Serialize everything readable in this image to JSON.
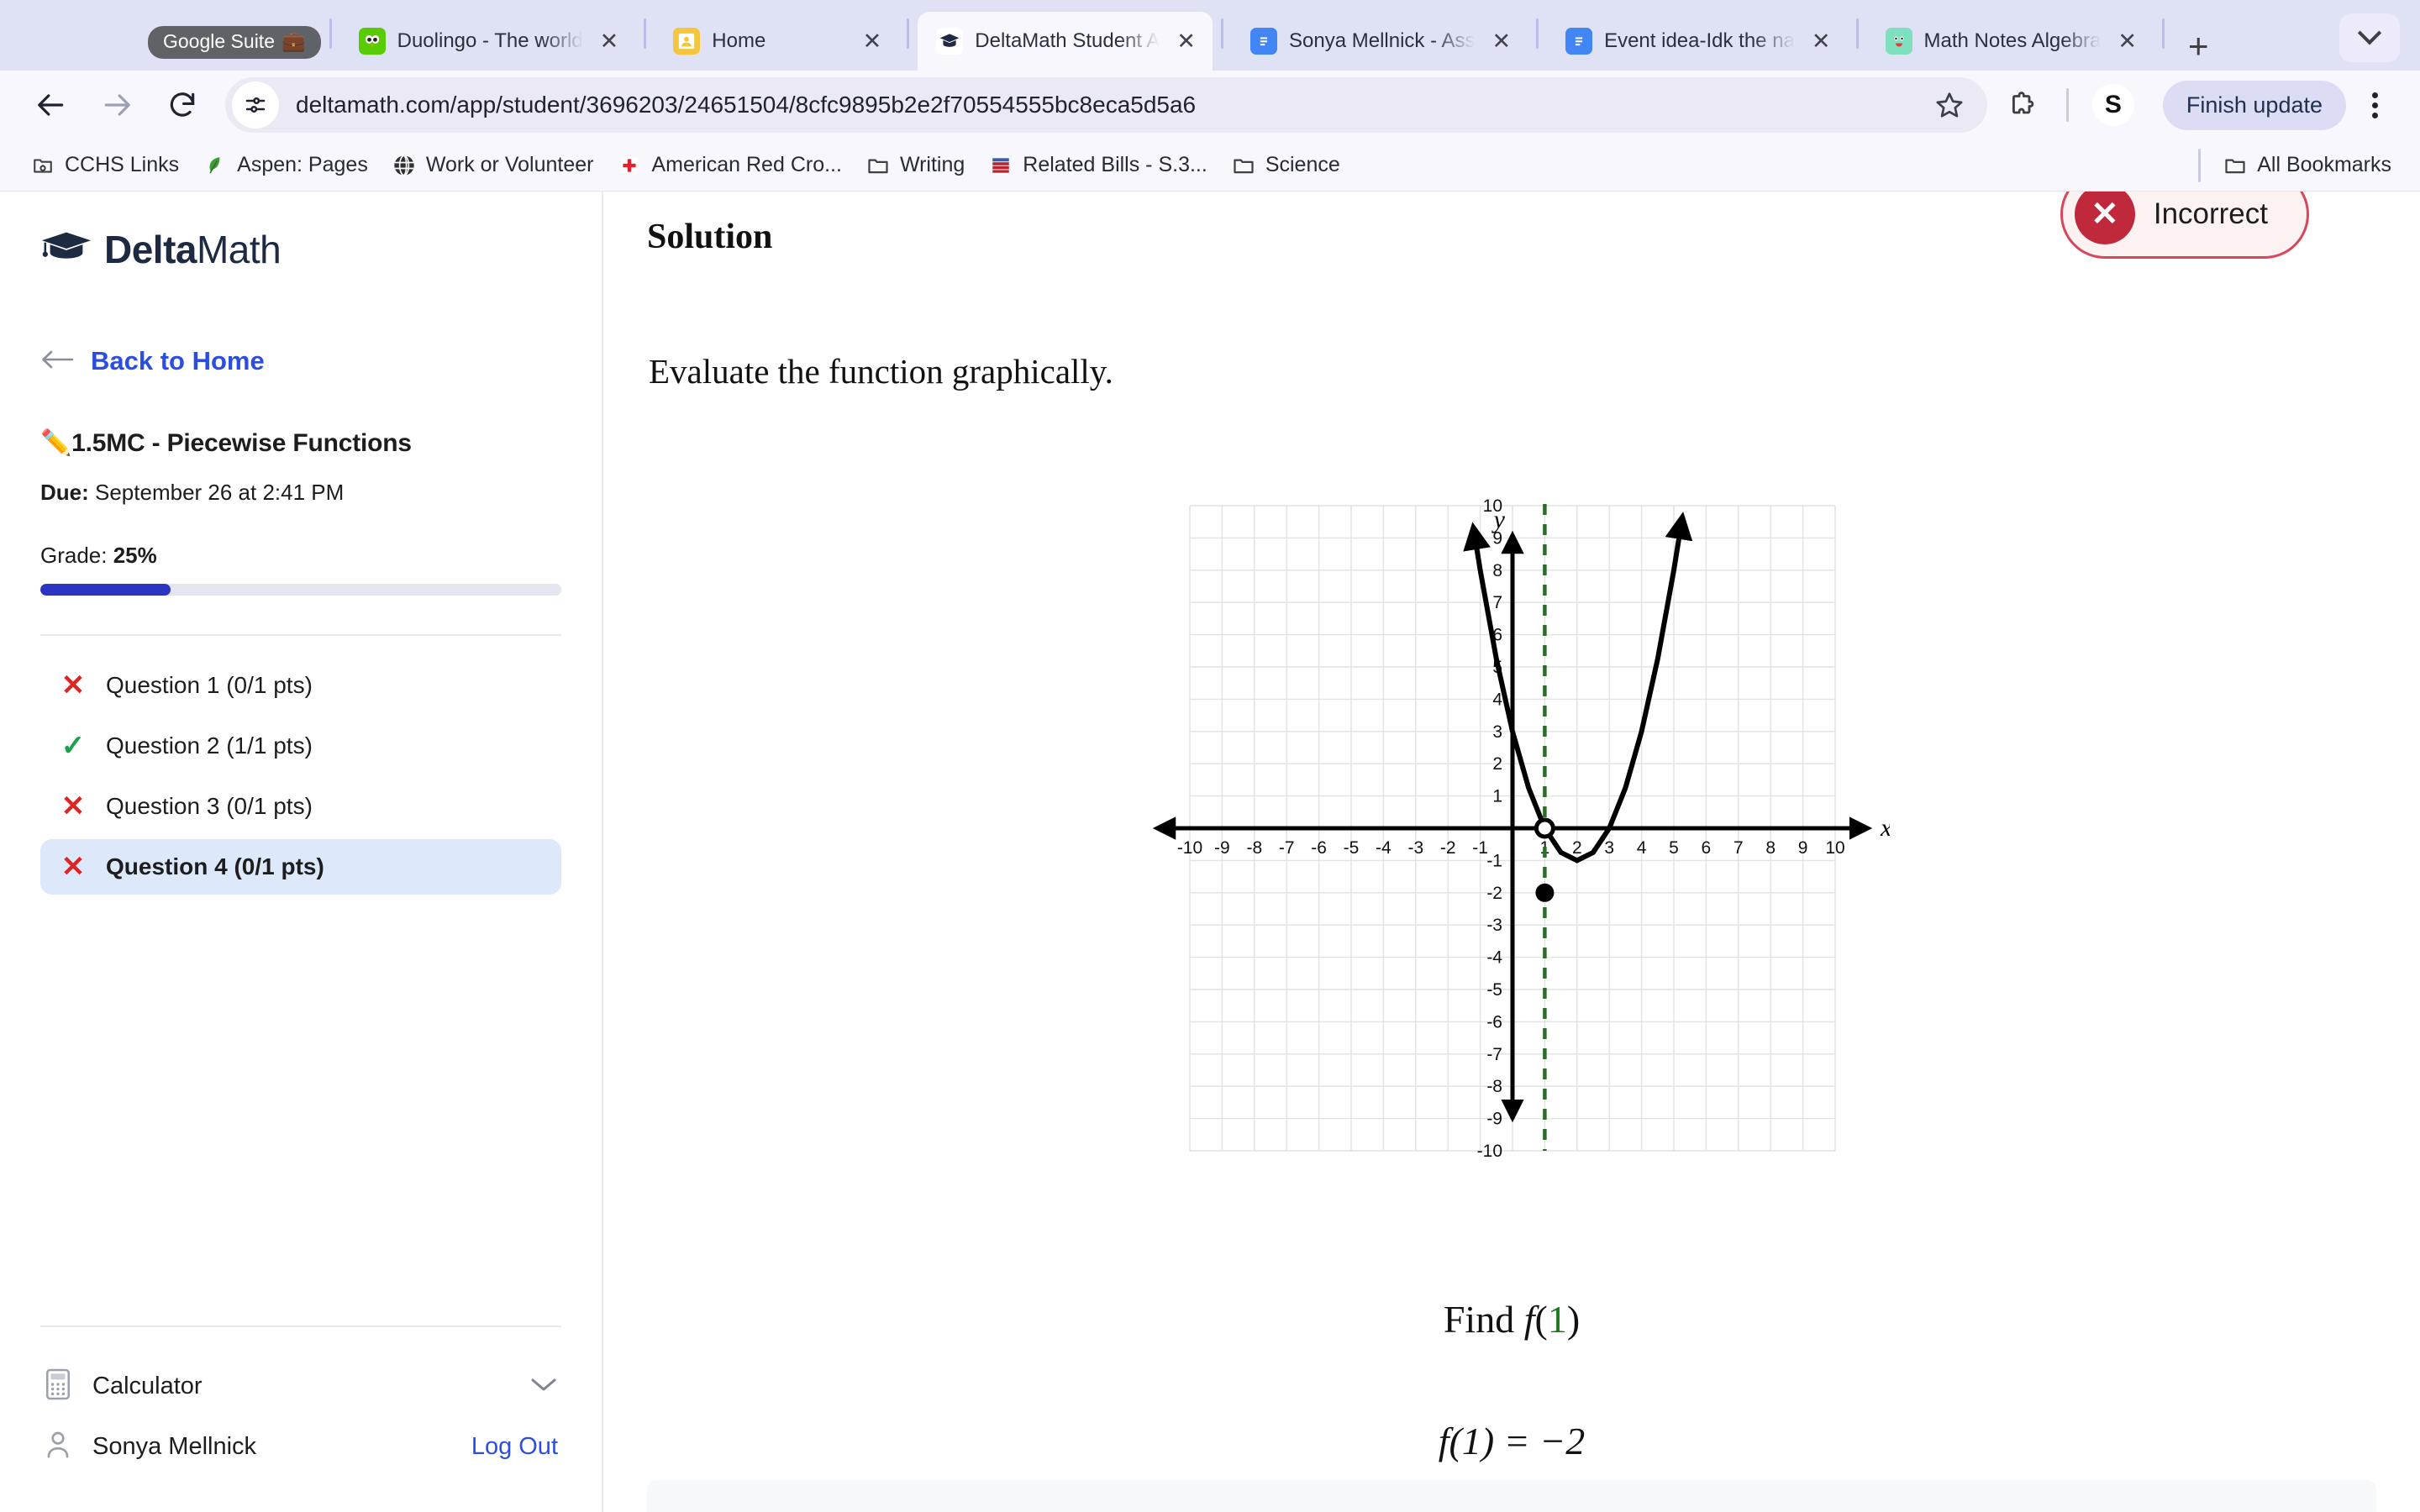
{
  "browser": {
    "tab_group": {
      "label": "Google Suite",
      "emoji": "💼"
    },
    "tabs": [
      {
        "title": "Duolingo - The world",
        "favicon": "duolingo-icon",
        "active": false,
        "close": "✕"
      },
      {
        "title": "Home",
        "favicon": "google-classroom-icon",
        "active": false,
        "close": "✕"
      },
      {
        "title": "DeltaMath Student A",
        "favicon": "deltamath-icon",
        "active": true,
        "close": "✕"
      },
      {
        "title": "Sonya Mellnick - Ass",
        "favicon": "google-docs-icon",
        "active": false,
        "close": "✕"
      },
      {
        "title": "Event idea-Idk the na",
        "favicon": "google-docs-icon",
        "active": false,
        "close": "✕"
      },
      {
        "title": "Math Notes Algebra",
        "favicon": "notes-app-icon",
        "active": false,
        "close": "✕"
      }
    ],
    "new_tab_label": "+",
    "tab_list_chevron": "chevron-down-icon",
    "nav": {
      "back": "back-arrow-icon",
      "forward": "forward-arrow-icon",
      "reload": "reload-icon"
    },
    "omnibox": {
      "site_info_icon": "site-settings-icon",
      "url": "deltamath.com/app/student/3696203/24651504/8cfc9895b2e2f70554555bc8eca5d5a6",
      "bookmark_icon": "star-icon"
    },
    "toolbar": {
      "extensions_icon": "puzzle-piece-icon",
      "profile_initial": "S",
      "update_button": "Finish update",
      "menu_icon": "kebab-menu-icon"
    },
    "bookmarks": [
      {
        "label": "CCHS Links",
        "icon": "link-bookmark-icon"
      },
      {
        "label": "Aspen: Pages",
        "icon": "leaf-icon"
      },
      {
        "label": "Work or Volunteer",
        "icon": "globe-icon"
      },
      {
        "label": "American Red Cro...",
        "icon": "red-cross-icon"
      },
      {
        "label": "Writing",
        "icon": "folder-icon"
      },
      {
        "label": "Related Bills - S.3...",
        "icon": "flag-icon"
      },
      {
        "label": "Science",
        "icon": "folder-icon"
      }
    ],
    "all_bookmarks": {
      "label": "All Bookmarks",
      "icon": "folder-icon"
    }
  },
  "sidebar": {
    "logo": {
      "bold": "Delta",
      "light": "Math",
      "icon": "graduation-cap-icon"
    },
    "back_link": {
      "label": "Back to Home",
      "icon": "left-arrow-icon"
    },
    "assignment_title": "✏️1.5MC - Piecewise Functions",
    "due_label": "Due:",
    "due_value": " September 26 at 2:41 PM",
    "grade_label": "Grade: ",
    "grade_value": "25%",
    "grade_percent": 25,
    "progress_color": "#2c34c4",
    "questions": [
      {
        "label": "Question 1 (0/1 pts)",
        "status": "incorrect",
        "mark": "✕",
        "selected": false
      },
      {
        "label": "Question 2 (1/1 pts)",
        "status": "correct",
        "mark": "✓",
        "selected": false
      },
      {
        "label": "Question 3 (0/1 pts)",
        "status": "incorrect",
        "mark": "✕",
        "selected": false
      },
      {
        "label": "Question 4 (0/1 pts)",
        "status": "incorrect",
        "mark": "✕",
        "selected": true
      }
    ],
    "calculator": {
      "label": "Calculator",
      "icon": "calculator-icon",
      "chevron": "chevron-down-icon"
    },
    "user": {
      "name": "Sonya Mellnick",
      "icon": "person-icon",
      "logout": "Log Out"
    }
  },
  "main": {
    "solution_heading": "Solution",
    "status_badge": {
      "label": "Incorrect",
      "mark": "✕",
      "color": "#c0283c"
    },
    "prompt": "Evaluate the function graphically.",
    "find_prefix": "Find ",
    "find_fn": "f",
    "find_open": "(",
    "find_arg": "1",
    "find_close": ")",
    "answer": "f(1) = −2"
  },
  "chart_data": {
    "type": "line",
    "title": "",
    "xlabel": "x",
    "ylabel": "y",
    "xlim": [
      -10,
      10
    ],
    "ylim": [
      -10,
      10
    ],
    "grid": true,
    "x_ticks": [
      -10,
      -9,
      -8,
      -7,
      -6,
      -5,
      -4,
      -3,
      -2,
      -1,
      1,
      2,
      3,
      4,
      5,
      6,
      7,
      8,
      9,
      10
    ],
    "y_ticks": [
      10,
      9,
      8,
      7,
      6,
      5,
      4,
      3,
      2,
      1,
      -1,
      -2,
      -3,
      -4,
      -5,
      -6,
      -7,
      -8,
      -9,
      -10
    ],
    "series": [
      {
        "name": "parabola",
        "equation": "y = (x - 2)^2 - 1",
        "color": "#000000",
        "x_domain": [
          -1.3,
          5.3
        ],
        "arrows": [
          "start",
          "end"
        ],
        "points": [
          {
            "x": -1.2,
            "y": 9.24
          },
          {
            "x": -1.0,
            "y": 8.0
          },
          {
            "x": -0.5,
            "y": 5.25
          },
          {
            "x": 0,
            "y": 3.0
          },
          {
            "x": 0.5,
            "y": 1.25
          },
          {
            "x": 1,
            "y": 0
          },
          {
            "x": 1.5,
            "y": -0.75
          },
          {
            "x": 2,
            "y": -1
          },
          {
            "x": 2.5,
            "y": -0.75
          },
          {
            "x": 3,
            "y": 0
          },
          {
            "x": 3.5,
            "y": 1.25
          },
          {
            "x": 4,
            "y": 3.0
          },
          {
            "x": 4.5,
            "y": 5.25
          },
          {
            "x": 5,
            "y": 8.0
          },
          {
            "x": 5.25,
            "y": 9.56
          }
        ]
      }
    ],
    "markers": [
      {
        "type": "open-circle",
        "x": 1,
        "y": 0,
        "color": "#000000"
      },
      {
        "type": "filled-circle",
        "x": 1,
        "y": -2,
        "color": "#000000"
      }
    ],
    "vertical_lines": [
      {
        "x": 1,
        "style": "dashed",
        "color": "#2d6b2d",
        "label": "x = 1"
      }
    ]
  }
}
